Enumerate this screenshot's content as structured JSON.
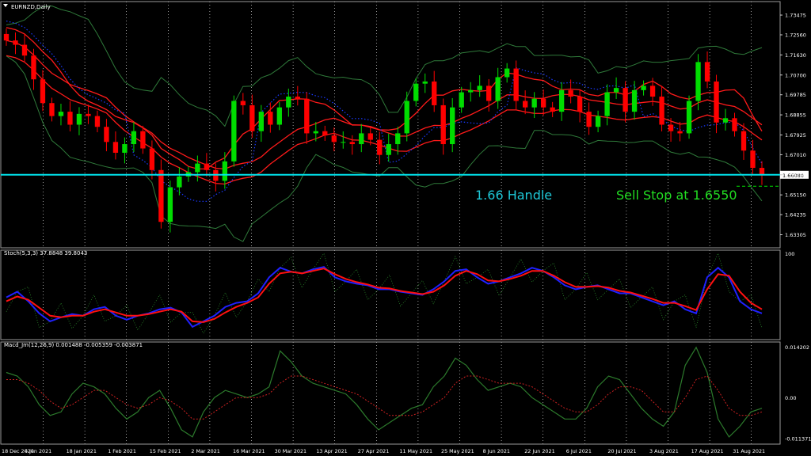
{
  "chart_data": [
    {
      "type": "candlestick",
      "symbol_label": "EURNZD,Daily",
      "ylim": [
        1.627,
        1.741
      ],
      "price_ticks": [
        "1.73475",
        "1.72560",
        "1.71630",
        "1.70700",
        "1.69785",
        "1.68855",
        "1.67925",
        "1.67010",
        "1.66080",
        "1.65150",
        "1.64235",
        "1.63305"
      ],
      "current_price": "1.66080",
      "horizontal_line": {
        "price": 1.6608,
        "color": "#00e5ee"
      },
      "annotations": [
        {
          "text": "1.66 Handle",
          "color": "#1ec8d8"
        },
        {
          "text": "Sell Stop at 1.6550",
          "color": "#22dd22"
        }
      ],
      "sell_stop_price": 1.6555,
      "close_path": [
        1.723,
        1.721,
        1.716,
        1.705,
        1.694,
        1.688,
        1.69,
        1.684,
        1.689,
        1.688,
        1.683,
        1.676,
        1.671,
        1.675,
        1.681,
        1.673,
        1.663,
        1.639,
        1.655,
        1.66,
        1.662,
        1.666,
        1.663,
        1.658,
        1.667,
        1.695,
        1.693,
        1.681,
        1.69,
        1.684,
        1.692,
        1.697,
        1.696,
        1.68,
        1.681,
        1.679,
        1.676,
        1.676,
        1.675,
        1.68,
        1.677,
        1.67,
        1.675,
        1.68,
        1.695,
        1.703,
        1.704,
        1.693,
        1.675,
        1.692,
        1.699,
        1.7,
        1.702,
        1.695,
        1.706,
        1.71,
        1.695,
        1.692,
        1.696,
        1.692,
        1.69,
        1.7,
        1.697,
        1.69,
        1.683,
        1.688,
        1.699,
        1.701,
        1.69,
        1.7,
        1.702,
        1.697,
        1.684,
        1.681,
        1.68,
        1.695,
        1.713,
        1.704,
        1.685,
        1.687,
        1.681,
        1.672,
        1.664,
        1.661
      ],
      "series": [
        {
          "color": "#ff1a1a"
        },
        {
          "color": "#2f7a3a"
        },
        {
          "color": "#1a3aff"
        }
      ]
    },
    {
      "type": "line",
      "label": "Stoch(5,3,3) 37.8848 39.8043",
      "ylim": [
        0,
        100
      ],
      "ticks": [
        "100"
      ],
      "main": [
        45,
        52,
        40,
        25,
        15,
        20,
        24,
        22,
        30,
        33,
        22,
        17,
        22,
        25,
        30,
        32,
        26,
        8,
        15,
        22,
        33,
        38,
        40,
        50,
        70,
        82,
        77,
        75,
        80,
        83,
        70,
        65,
        62,
        60,
        55,
        55,
        52,
        50,
        48,
        55,
        65,
        78,
        80,
        70,
        62,
        65,
        70,
        75,
        82,
        78,
        70,
        60,
        55,
        58,
        60,
        55,
        50,
        50,
        45,
        40,
        35,
        40,
        30,
        25,
        70,
        82,
        70,
        40,
        30,
        25
      ],
      "signal": [
        40,
        46,
        42,
        32,
        22,
        20,
        22,
        22,
        27,
        30,
        26,
        22,
        22,
        24,
        27,
        30,
        27,
        15,
        14,
        18,
        26,
        33,
        38,
        45,
        62,
        75,
        77,
        75,
        78,
        81,
        74,
        68,
        64,
        61,
        57,
        56,
        53,
        51,
        49,
        52,
        60,
        72,
        78,
        74,
        66,
        65,
        68,
        72,
        78,
        78,
        72,
        64,
        58,
        58,
        59,
        57,
        53,
        51,
        47,
        43,
        38,
        38,
        34,
        29,
        55,
        74,
        72,
        52,
        38,
        30
      ]
    },
    {
      "type": "line",
      "label": "Macd_Jm(12,26,9) 0.001488 -0.005359 -0.003871",
      "ylim": [
        -0.013,
        0.0155
      ],
      "ticks": [
        "0.014202",
        "0.00",
        "-0.011371"
      ],
      "macd": [
        0.007,
        0.006,
        0.003,
        -0.002,
        -0.005,
        -0.004,
        0.001,
        0.004,
        0.003,
        0.001,
        -0.003,
        -0.006,
        -0.004,
        0.0,
        0.002,
        -0.003,
        -0.009,
        -0.011,
        -0.004,
        0.0,
        0.002,
        0.001,
        0.0,
        0.001,
        0.003,
        0.013,
        0.01,
        0.006,
        0.004,
        0.003,
        0.002,
        0.001,
        -0.002,
        -0.006,
        -0.009,
        -0.007,
        -0.005,
        -0.003,
        -0.002,
        0.003,
        0.006,
        0.011,
        0.009,
        0.005,
        0.002,
        0.003,
        0.004,
        0.003,
        0.0,
        -0.002,
        -0.004,
        -0.006,
        -0.006,
        -0.003,
        0.003,
        0.006,
        0.005,
        0.001,
        -0.003,
        -0.006,
        -0.008,
        -0.004,
        0.009,
        0.014,
        0.007,
        -0.006,
        -0.011,
        -0.008,
        -0.004,
        -0.003
      ],
      "signal": [
        0.005,
        0.005,
        0.004,
        0.002,
        -0.001,
        -0.003,
        -0.002,
        0.0,
        0.002,
        0.002,
        0.0,
        -0.002,
        -0.003,
        -0.002,
        0.0,
        -0.001,
        -0.003,
        -0.006,
        -0.006,
        -0.004,
        -0.002,
        0.0,
        0.0,
        0.0,
        0.001,
        0.004,
        0.006,
        0.006,
        0.005,
        0.004,
        0.003,
        0.002,
        0.001,
        -0.001,
        -0.003,
        -0.005,
        -0.005,
        -0.005,
        -0.004,
        -0.002,
        0.0,
        0.004,
        0.006,
        0.006,
        0.005,
        0.004,
        0.004,
        0.004,
        0.003,
        0.001,
        -0.001,
        -0.003,
        -0.004,
        -0.004,
        -0.002,
        0.001,
        0.003,
        0.003,
        0.002,
        -0.001,
        -0.004,
        -0.004,
        0.0,
        0.005,
        0.006,
        0.002,
        -0.003,
        -0.005,
        -0.005,
        -0.004
      ]
    }
  ],
  "x_axis": {
    "labels": [
      "18 Dec 2020",
      "4 Jan 2021",
      "18 Jan 2021",
      "1 Feb 2021",
      "15 Feb 2021",
      "2 Mar 2021",
      "16 Mar 2021",
      "30 Mar 2021",
      "13 Apr 2021",
      "27 Apr 2021",
      "11 May 2021",
      "25 May 2021",
      "8 Jun 2021",
      "22 Jun 2021",
      "6 Jul 2021",
      "20 Jul 2021",
      "3 Aug 2021",
      "17 Aug 2021",
      "31 Aug 2021"
    ]
  },
  "colors": {
    "background": "#000000",
    "grid": "#ffffff",
    "axis_text": "#ffffff",
    "bull": "#00dd00",
    "bear": "#ff0000",
    "stoch_main": "#2020ff",
    "stoch_signal": "#ff1010",
    "stoch_raw": "#2a8a2a",
    "macd_line": "#2c7a2c",
    "macd_signal": "#cc2020"
  }
}
